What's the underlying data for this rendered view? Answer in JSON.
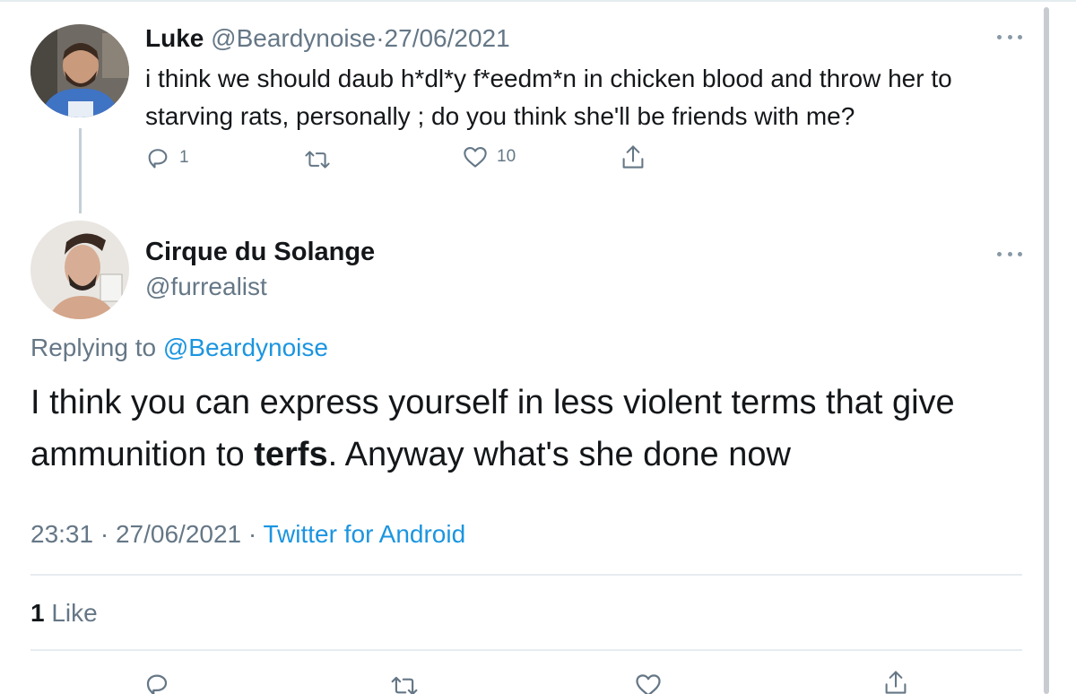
{
  "parent_tweet": {
    "name": "Luke",
    "handle": "@Beardynoise",
    "separator": "·",
    "date": "27/06/2021",
    "text": "i think we should daub h*dl*y f*eedm*n in chicken blood and throw her to starving rats, personally ; do you think she'll be friends with me?",
    "reply_count": "1",
    "like_count": "10",
    "icons": [
      "reply-icon",
      "retweet-icon",
      "like-icon",
      "share-icon",
      "more-icon"
    ]
  },
  "reply_tweet": {
    "name": "Cirque du Solange",
    "handle": "@furrealist",
    "replying_prefix": "Replying to",
    "replying_to": "@Beardynoise",
    "text_before": "I think you can express yourself in less violent terms that give ammunition to ",
    "text_bold": "terfs",
    "text_after": ". Anyway what's she done now",
    "time": "23:31",
    "separator": "·",
    "date": "27/06/2021",
    "source": "Twitter for Android",
    "likes_count": "1",
    "likes_label": "Like"
  },
  "colors": {
    "text_primary": "#14171a",
    "text_secondary": "#657786",
    "link": "#1b95e0",
    "divider": "#e6ecf0"
  }
}
